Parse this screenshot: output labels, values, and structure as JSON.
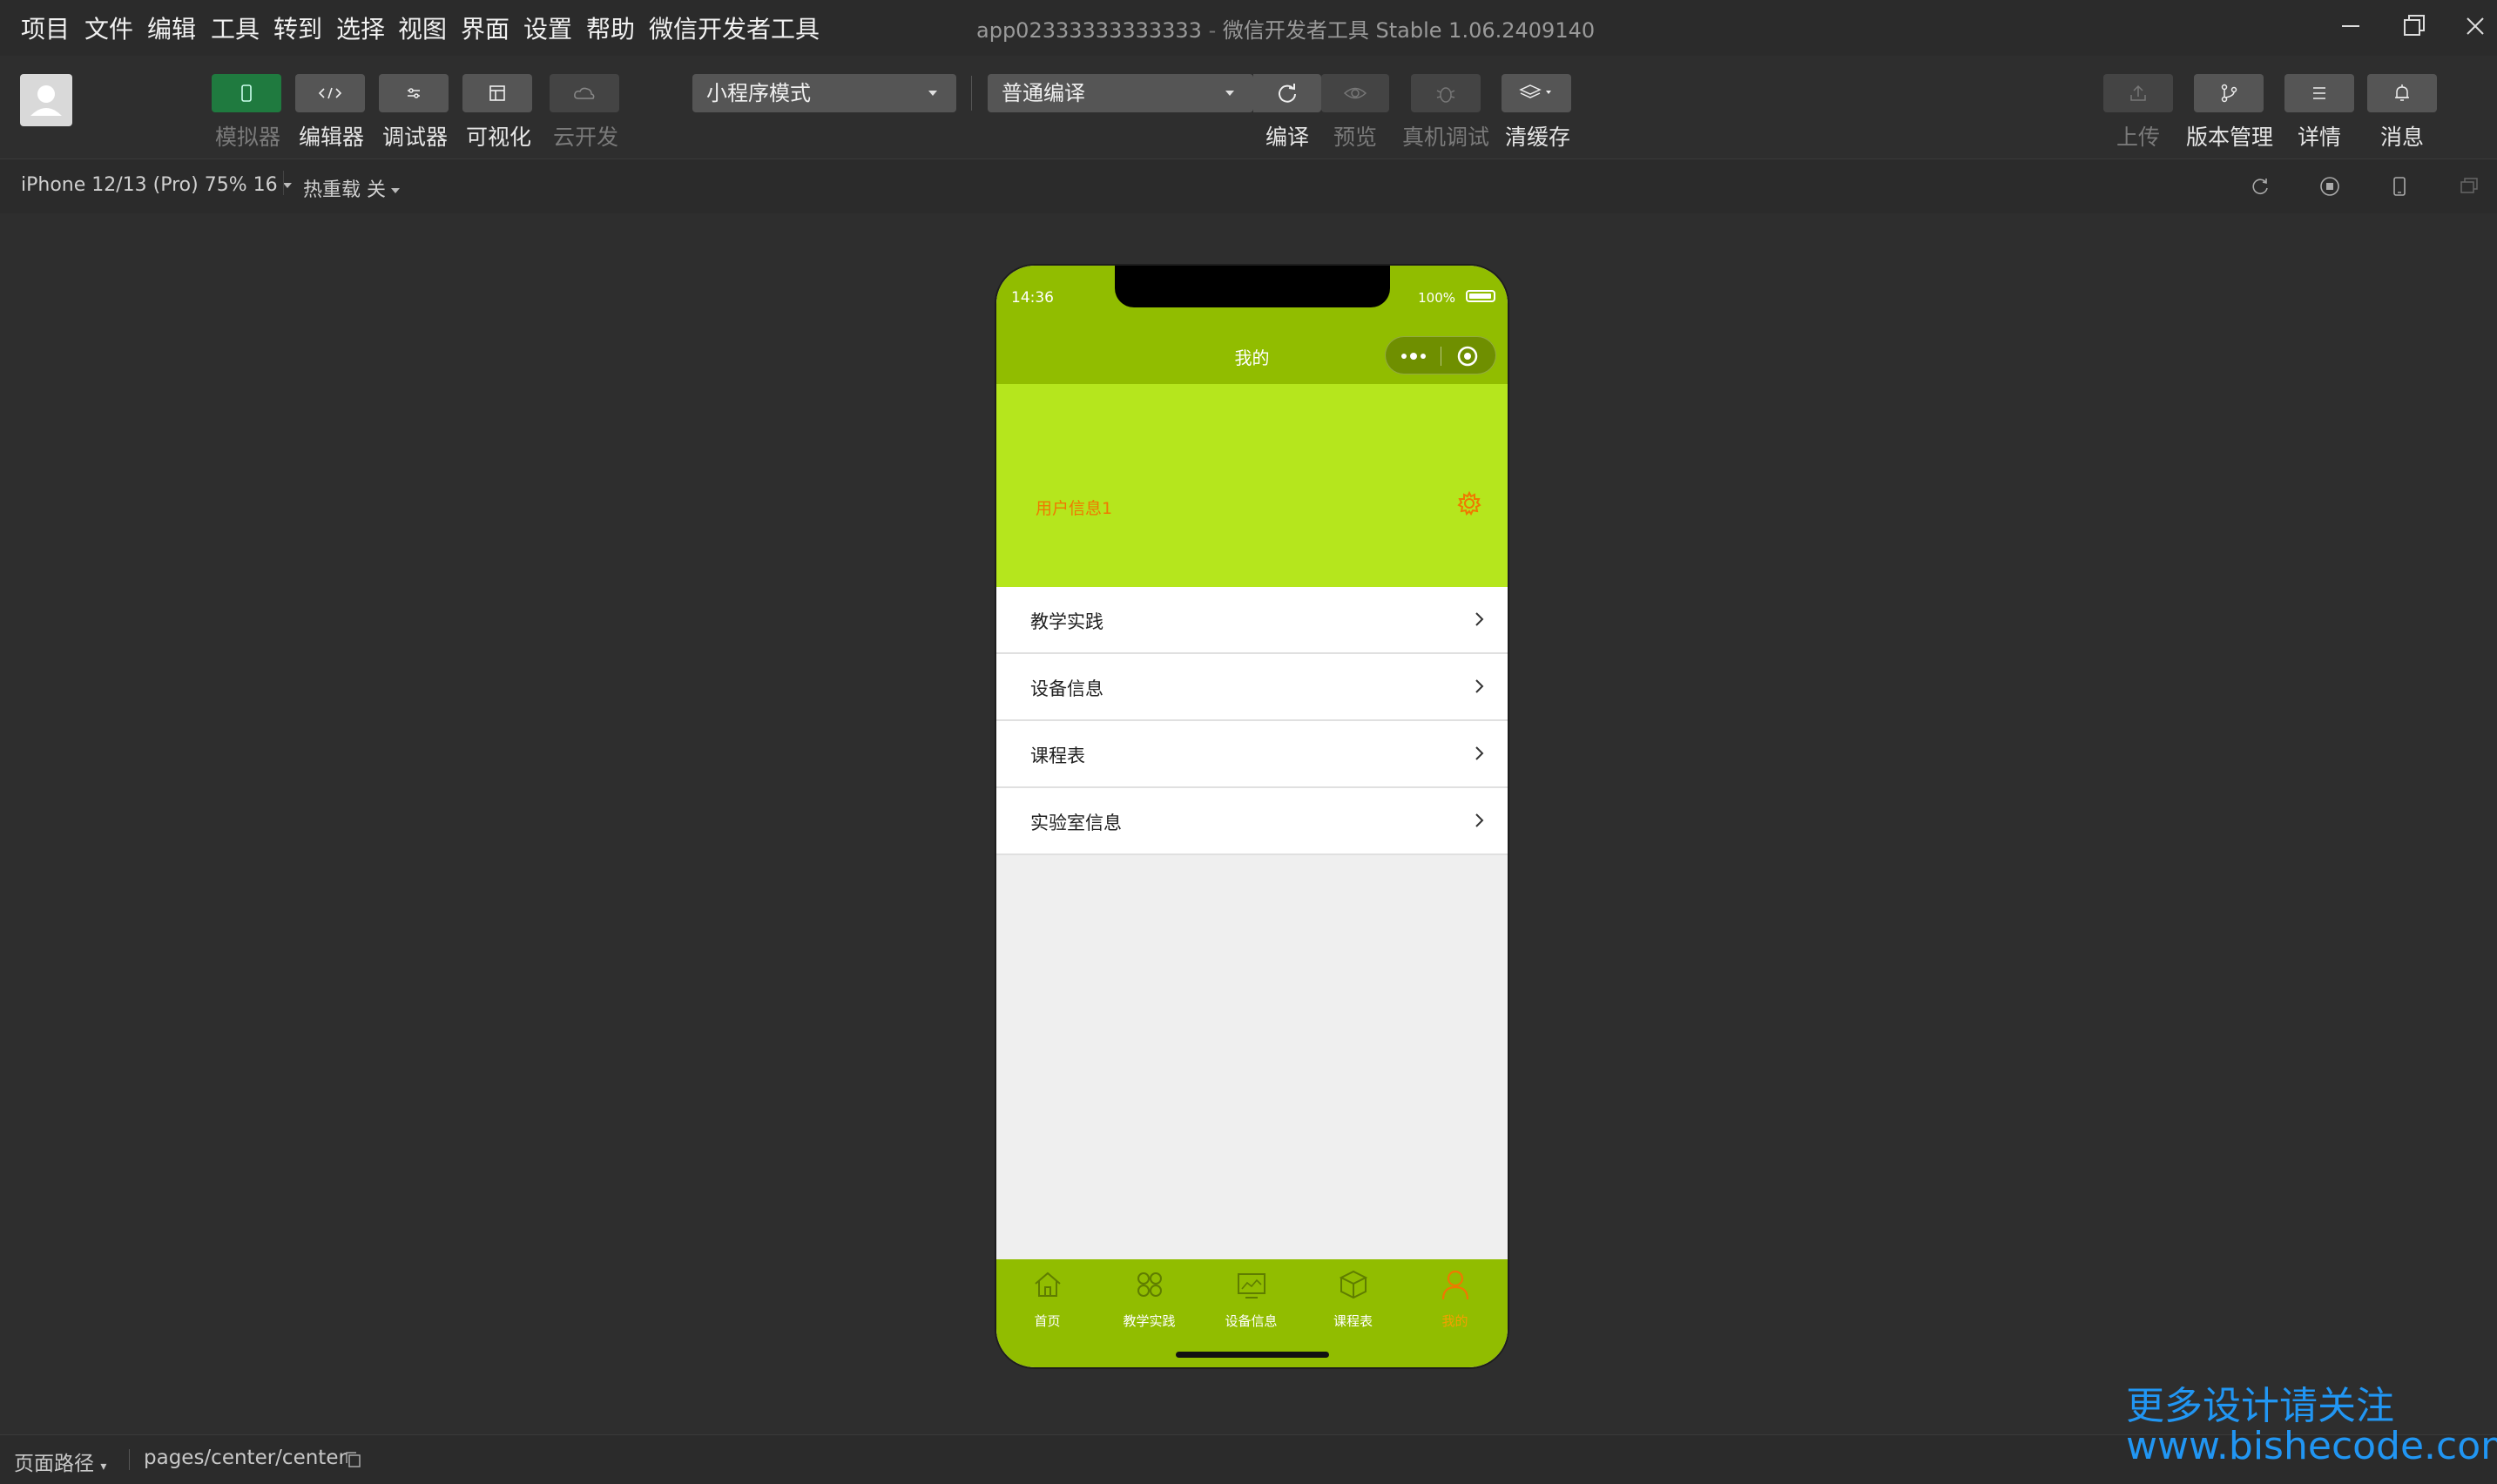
{
  "menubar": {
    "items": [
      "项目",
      "文件",
      "编辑",
      "工具",
      "转到",
      "选择",
      "视图",
      "界面",
      "设置",
      "帮助",
      "微信开发者工具"
    ]
  },
  "window": {
    "project": "app02333333333333",
    "separator": "-",
    "app_name": "微信开发者工具 Stable 1.06.2409140"
  },
  "toolbar": {
    "left_buttons": [
      {
        "label": "模拟器",
        "icon": "phone-icon",
        "state": "active"
      },
      {
        "label": "编辑器",
        "icon": "code-icon",
        "state": "normal"
      },
      {
        "label": "调试器",
        "icon": "debug-sliders-icon",
        "state": "normal"
      },
      {
        "label": "可视化",
        "icon": "layout-icon",
        "state": "normal"
      },
      {
        "label": "云开发",
        "icon": "cloud-icon",
        "state": "disabled"
      }
    ],
    "mode_select": "小程序模式",
    "compile_select": "普通编译",
    "center_buttons": [
      {
        "label": "编译",
        "icon": "refresh-icon",
        "state": "normal"
      },
      {
        "label": "预览",
        "icon": "eye-icon",
        "state": "disabled"
      },
      {
        "label": "真机调试",
        "icon": "bug-icon",
        "state": "disabled"
      },
      {
        "label": "清缓存",
        "icon": "layers-icon",
        "state": "normal"
      }
    ],
    "right_buttons": [
      {
        "label": "上传",
        "icon": "upload-icon",
        "state": "disabled"
      },
      {
        "label": "版本管理",
        "icon": "branch-icon",
        "state": "normal"
      },
      {
        "label": "详情",
        "icon": "menu-lines-icon",
        "state": "normal"
      },
      {
        "label": "消息",
        "icon": "bell-icon",
        "state": "normal"
      }
    ]
  },
  "devicebar": {
    "device": "iPhone 12/13 (Pro) 75% 16",
    "hot_reload": "热重载 关"
  },
  "phone": {
    "time": "14:36",
    "battery": "100%",
    "nav_title": "我的",
    "user_info": "用户信息1",
    "menu": [
      "教学实践",
      "设备信息",
      "课程表",
      "实验室信息"
    ],
    "tabs": [
      {
        "label": "首页",
        "icon": "home-icon",
        "active": false
      },
      {
        "label": "教学实践",
        "icon": "grid-icon",
        "active": false
      },
      {
        "label": "设备信息",
        "icon": "monitor-icon",
        "active": false
      },
      {
        "label": "课程表",
        "icon": "cube-icon",
        "active": false
      },
      {
        "label": "我的",
        "icon": "user-icon",
        "active": true
      }
    ],
    "colors": {
      "bar": "#91bd00",
      "banner": "#b5e61d",
      "accent": "#f07800"
    }
  },
  "bottombar": {
    "path_label": "页面路径",
    "path_value": "pages/center/center"
  },
  "watermark": {
    "line1": "更多设计请关注",
    "line2": "www.bishecode.com"
  }
}
